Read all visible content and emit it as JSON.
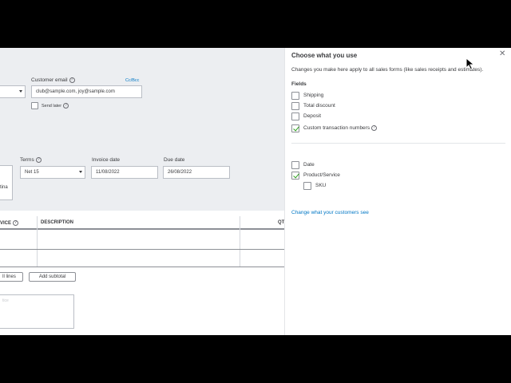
{
  "form": {
    "customer_email_label": "Customer email",
    "cc_bcc": "Cc/Bcc",
    "customer_email_value": "club@sample.com, joy@sample.com",
    "send_later_label": "Send later",
    "terms_label": "Terms",
    "terms_value": "Net 15",
    "invoice_date_label": "Invoice date",
    "invoice_date_value": "11/08/2022",
    "due_date_label": "Due date",
    "due_date_value": "26/08/2022",
    "address_fragment": "tina",
    "table": {
      "col_service": "VICE",
      "col_description": "DESCRIPTION",
      "col_qty": "QT"
    },
    "clear_lines_label": "ll lines",
    "add_subtotal_label": "Add subtotal",
    "memo_placeholder": "tice"
  },
  "panel": {
    "title": "Choose what you use",
    "description": "Changes you make here apply to all sales forms (like sales receipts and estimates).",
    "fields_heading": "Fields",
    "options": [
      {
        "label": "Shipping",
        "checked": false
      },
      {
        "label": "Total discount",
        "checked": false
      },
      {
        "label": "Deposit",
        "checked": false
      },
      {
        "label": "Custom transaction numbers",
        "checked": true
      }
    ],
    "columns": [
      {
        "label": "Date",
        "checked": false
      },
      {
        "label": "Product/Service",
        "checked": true
      },
      {
        "label": "SKU",
        "checked": false
      }
    ],
    "customer_link": "Change what your customers see"
  },
  "icons": {
    "close": "close-icon",
    "help": "help-icon",
    "cursor": "mouse-pointer-icon"
  },
  "colors": {
    "link": "#0077c5",
    "check": "#2ca01c",
    "header_bg": "#eceef1"
  }
}
